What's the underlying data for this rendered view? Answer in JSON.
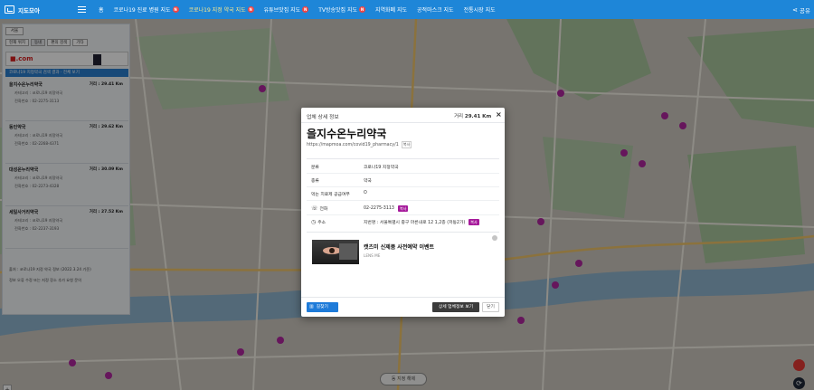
{
  "nav": {
    "brand": "지도모아",
    "items": [
      {
        "label": "홈",
        "badge": ""
      },
      {
        "label": "코로나19 진료 병원 지도",
        "badge": "N"
      },
      {
        "label": "코로나19 지정 약국 지도",
        "badge": "N"
      },
      {
        "label": "유튜브맛집 지도",
        "badge": "N"
      },
      {
        "label": "TV방송맛집 지도",
        "badge": "N"
      },
      {
        "label": "지역화폐 지도",
        "badge": ""
      },
      {
        "label": "공적마스크 지도",
        "badge": ""
      },
      {
        "label": "전통시장 지도",
        "badge": ""
      }
    ],
    "share_label": "공유"
  },
  "sidebar": {
    "home_label": "서울",
    "filters": [
      "현재 위치",
      "동네",
      "편의 검색",
      "기타"
    ],
    "ad_logo": "■.com",
    "list_header": "코로나19 지정약국 검색 결과 · 전체 보기",
    "items": [
      {
        "name": "을지수온누리약국",
        "dist": "거리 : 29.41 Km",
        "line1": "카테고리 : 코로나19 지정약국",
        "line2": "전화번호 : 02-2275-3113"
      },
      {
        "name": "동인약국",
        "dist": "거리 : 29.62 Km",
        "line1": "카테고리 : 코로나19 지정약국",
        "line2": "전화번호 : 02-2268-4371"
      },
      {
        "name": "대성온누리약국",
        "dist": "거리 : 30.09 Km",
        "line1": "카테고리 : 코로나19 지정약국",
        "line2": "전화번호 : 02-2273-4328"
      },
      {
        "name": "세일사거리약국",
        "dist": "거리 : 27.52 Km",
        "line1": "카테고리 : 코로나19 지정약국",
        "line2": "전화번호 : 02-2237-3193"
      }
    ],
    "footer1": "출처 : 코로나19 지정 약국 정보 (2022.3.24 기준)",
    "footer2": "정보 오류 수정 또는 지정 장소 추가 요청 문의"
  },
  "map": {
    "tag": "동 지정 해제",
    "refresh_glyph": "⟳"
  },
  "modal": {
    "header_title": "업체 상세 정보",
    "dist_label": "거리",
    "dist_value": "29.41 Km",
    "close_glyph": "×",
    "name": "을지수온누리약국",
    "url": "https://mapmoa.com/covid19_pharmacy/1",
    "copy_label": "복사",
    "rows": [
      {
        "icon": "",
        "label": "분류",
        "value": "코로나19 지정약국",
        "badge": ""
      },
      {
        "icon": "",
        "label": "종류",
        "value": "약국",
        "badge": ""
      },
      {
        "icon": "",
        "label": "먹는 치료제 공급여부",
        "value": "O",
        "badge": ""
      },
      {
        "icon": "☏",
        "label": "전화",
        "value": "02-2275-3113",
        "badge": "복사"
      },
      {
        "icon": "◷",
        "label": "주소",
        "value": "지번명 : 서울특별시 중구 마른내로 12 1,2층 (저동2가)",
        "badge": "복사"
      }
    ],
    "ad": {
      "title": "캣츠미 신제품 사전예약 이벤트",
      "subtitle": "LENS ME"
    },
    "btn_route": "길찾기",
    "btn_detail": "상세 업체정보 보기",
    "btn_close": "닫기"
  },
  "colors": {
    "nav_bg": "#1e86d8",
    "nav_active": "#ffe98a",
    "badge_red": "#ef4444",
    "copy_badge": "#a61a9b",
    "route_btn": "#1e7bd9",
    "detail_btn": "#3b3b3b"
  }
}
